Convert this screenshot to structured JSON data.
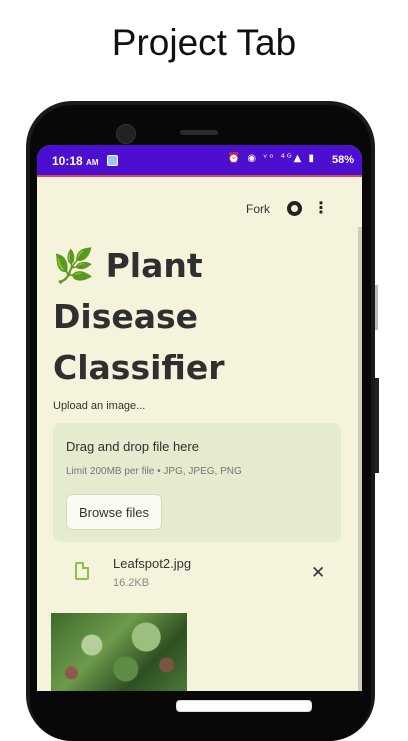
{
  "caption": "Project Tab",
  "statusbar": {
    "time": "10:18",
    "ampm": "AM",
    "icons": "⏰ ◉ ᵛᵒ ⁴ᴳ▲ ▮",
    "battery": "58%"
  },
  "header": {
    "fork_label": "Fork"
  },
  "app": {
    "title_emoji": "🌿",
    "title_line1": "Plant",
    "title_line2": "Disease",
    "title_line3": "Classifier",
    "upload_label": "Upload an image..."
  },
  "uploader": {
    "drop_title": "Drag and drop file here",
    "drop_sub": "Limit 200MB per file • JPG, JPEG, PNG",
    "browse_label": "Browse files"
  },
  "file": {
    "name": "Leafspot2.jpg",
    "size": "16.2KB",
    "close_glyph": "✕"
  },
  "colors": {
    "statusbar": "#4c0ecf",
    "background": "#f5f3dc",
    "dropzone": "#e4ebcf",
    "accent_green": "#8bc24a"
  }
}
